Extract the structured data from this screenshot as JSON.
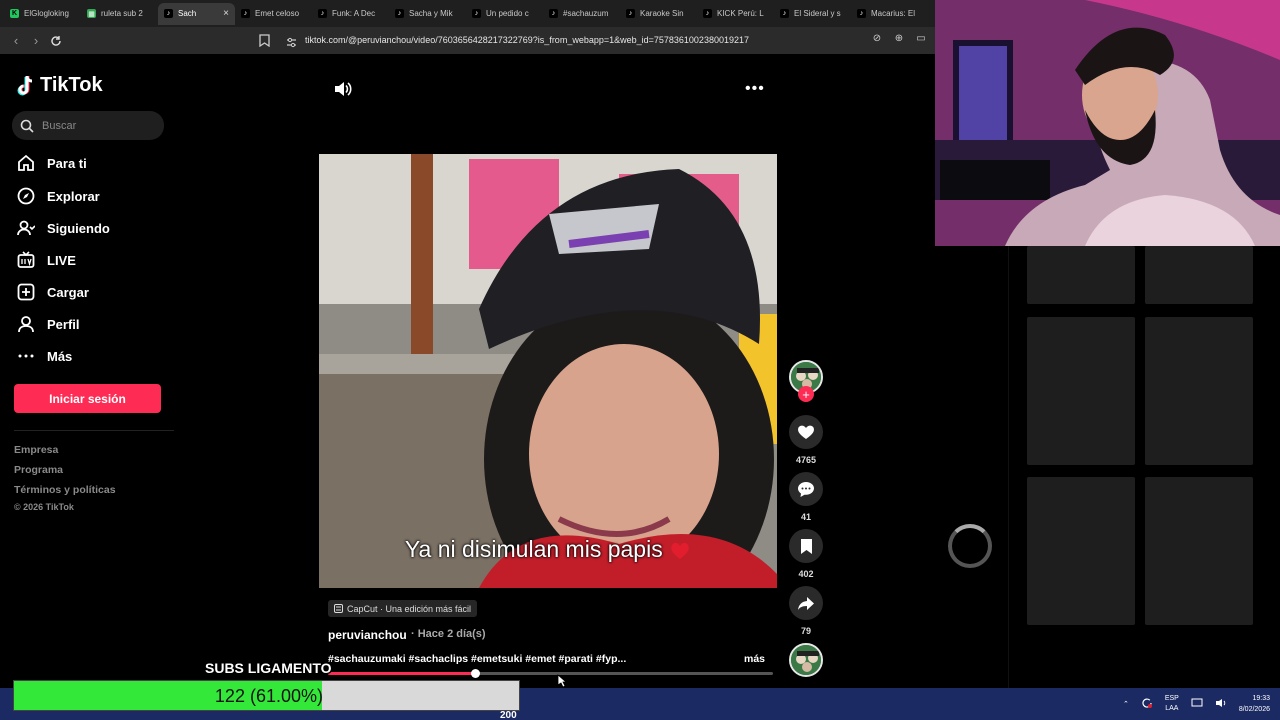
{
  "browser": {
    "tabs": [
      {
        "label": "ElGlogloking",
        "fav": "k"
      },
      {
        "label": "ruleta sub 2",
        "fav": "g"
      },
      {
        "label": "Sach",
        "fav": "t",
        "active": true
      },
      {
        "label": "Emet celoso",
        "fav": "t"
      },
      {
        "label": "Funk: A Dec",
        "fav": "t"
      },
      {
        "label": "Sacha y Mik",
        "fav": "t"
      },
      {
        "label": "Un pedido c",
        "fav": "t"
      },
      {
        "label": "#sachauzum",
        "fav": "t"
      },
      {
        "label": "Karaoke Sin",
        "fav": "t"
      },
      {
        "label": "KICK Perú: L",
        "fav": "t"
      },
      {
        "label": "El Sideral y s",
        "fav": "t"
      },
      {
        "label": "Macarius: El",
        "fav": "t"
      }
    ],
    "url": "tiktok.com/@peruvianchou/video/7603656428217322769?is_from_webapp=1&web_id=7578361002380019217"
  },
  "sidebar": {
    "logo": "TikTok",
    "search_placeholder": "Buscar",
    "nav": [
      {
        "label": "Para ti",
        "icon": "home-icon"
      },
      {
        "label": "Explorar",
        "icon": "compass-icon"
      },
      {
        "label": "Siguiendo",
        "icon": "following-icon"
      },
      {
        "label": "LIVE",
        "icon": "live-icon"
      },
      {
        "label": "Cargar",
        "icon": "upload-icon"
      },
      {
        "label": "Perfil",
        "icon": "profile-icon"
      },
      {
        "label": "Más",
        "icon": "more-icon"
      }
    ],
    "login_label": "Iniciar sesión",
    "footer": [
      "Empresa",
      "Programa",
      "Términos y políticas"
    ],
    "copyright": "© 2026 TikTok"
  },
  "video": {
    "caption": "Ya ni disimulan mis papis",
    "capcut": "CapCut · Una edición más fácil",
    "author": "peruvianchou",
    "time": "· Hace 2 día(s)",
    "tags": "#sachauzumaki #sachaclips #emetsuki #emet #parati #fyp...",
    "more_label": "más",
    "progress": 0.33
  },
  "actions": {
    "likes": "4765",
    "comments": "41",
    "saves": "402",
    "shares": "79"
  },
  "overlay": {
    "subs_title": "SUBS LIGAMENTO",
    "subs_text": "122 (61.00%)",
    "subs_fraction": 0.61,
    "taskbar_num": "200"
  },
  "tray": {
    "lang_top": "ESP",
    "lang_bottom": "LAA",
    "time": "19:33",
    "date": "8/02/2026"
  },
  "colors": {
    "accent": "#fe2c55",
    "subs_fill": "#34e83a",
    "taskbar": "#1c2a63"
  }
}
